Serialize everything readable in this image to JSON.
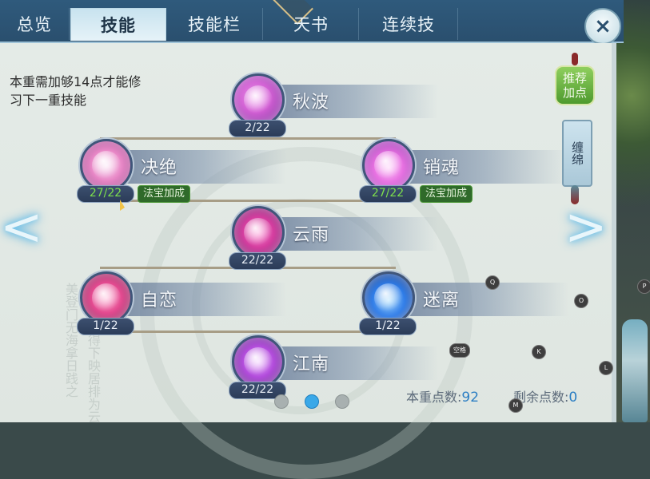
{
  "tabs": [
    {
      "label": "总览",
      "active": false
    },
    {
      "label": "技能",
      "active": true
    },
    {
      "label": "技能栏",
      "active": false
    },
    {
      "label": "天书",
      "active": false
    },
    {
      "label": "连续技",
      "active": false
    }
  ],
  "close_label": "×",
  "requirement_text": "本重需加够14点才能修习下一重技能",
  "watermark_text": "相门而海得下映居排为云美登门无海拿日践之",
  "skills": [
    {
      "name": "秋波",
      "level": "2/22",
      "icon": "autumn-wave-skill-icon",
      "bonus": ""
    },
    {
      "name": "决绝",
      "level": "27/22",
      "icon": "resolve-skill-icon",
      "bonus": "法宝加成"
    },
    {
      "name": "销魂",
      "level": "27/22",
      "icon": "lotus-skill-icon",
      "bonus": "法宝加成"
    },
    {
      "name": "云雨",
      "level": "22/22",
      "icon": "cloud-rain-skill-icon",
      "bonus": ""
    },
    {
      "name": "自恋",
      "level": "1/22",
      "icon": "shield-skill-icon",
      "bonus": ""
    },
    {
      "name": "迷离",
      "level": "1/22",
      "icon": "blue-flame-skill-icon",
      "bonus": ""
    },
    {
      "name": "江南",
      "level": "22/22",
      "icon": "river-south-skill-icon",
      "bonus": ""
    }
  ],
  "recommend_button": "推荐加点",
  "entangle_tab": "缠绵",
  "prev_arrow": "<",
  "next_arrow": ">",
  "page_indicator": {
    "count": 3,
    "active_index": 1
  },
  "points": {
    "tier_label": "本重点数:",
    "tier_value": "92",
    "remaining_label": "剩余点数:",
    "remaining_value": "0"
  },
  "key_hints": [
    "Q",
    "P",
    "O",
    "K",
    "空格",
    "L",
    "M"
  ],
  "colors": {
    "tab_bar": "#2f5a7c",
    "active_tab": "#d6ebf3",
    "panel_bg": "#e2e9e4",
    "bonus_green": "#2f6a2a",
    "level_over_cap": "#7ee04c",
    "points_value": "#2d7fc4"
  }
}
